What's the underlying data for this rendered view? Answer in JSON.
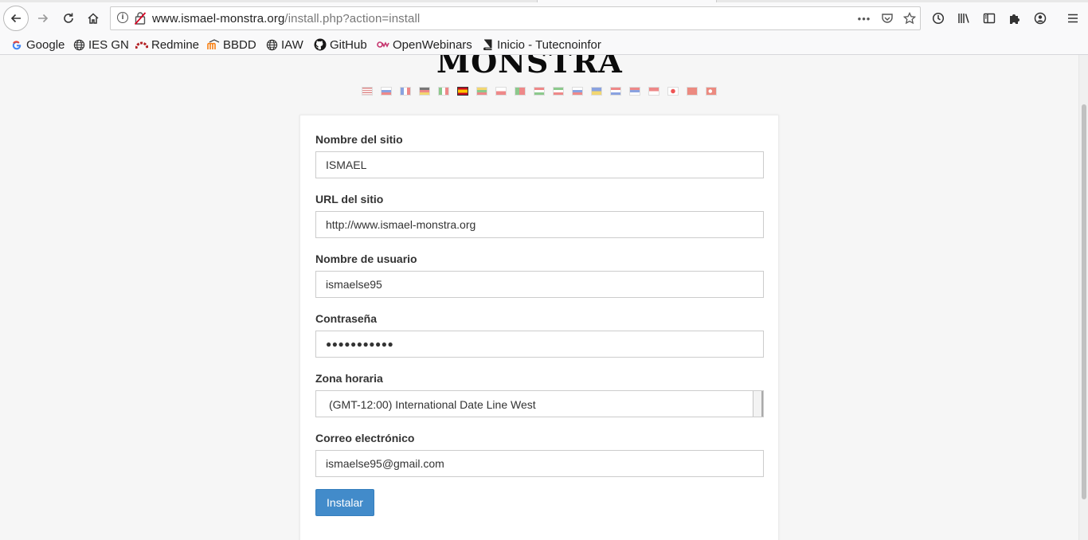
{
  "browser": {
    "url_host": "www.ismael-monstra.org",
    "url_path": "/install.php?action=install",
    "bookmarks": [
      {
        "label": "Google",
        "icon": "google-icon"
      },
      {
        "label": "IES GN",
        "icon": "globe-icon"
      },
      {
        "label": "Redmine",
        "icon": "redmine-icon"
      },
      {
        "label": "BBDD",
        "icon": "moodle-icon"
      },
      {
        "label": "IAW",
        "icon": "globe-icon"
      },
      {
        "label": "GitHub",
        "icon": "github-icon"
      },
      {
        "label": "OpenWebinars",
        "icon": "openwebinars-icon"
      },
      {
        "label": "Inicio - Tutecnoinfor",
        "icon": "book-icon"
      }
    ]
  },
  "page": {
    "logo": "MONSTRA",
    "languages": [
      "en",
      "ru",
      "fr",
      "de",
      "it",
      "es",
      "lt",
      "pl",
      "pt",
      "hu",
      "ir",
      "sk",
      "ua",
      "nl",
      "sr",
      "id",
      "ja",
      "zh",
      "tr"
    ],
    "form": {
      "site_name_label": "Nombre del sitio",
      "site_name_value": "ISMAEL",
      "site_url_label": "URL del sitio",
      "site_url_value": "http://www.ismael-monstra.org",
      "username_label": "Nombre de usuario",
      "username_value": "ismaelse95",
      "password_label": "Contraseña",
      "password_value": "●●●●●●●●●●●",
      "timezone_label": "Zona horaria",
      "timezone_value": "(GMT-12:00) International Date Line West",
      "email_label": "Correo electrónico",
      "email_value": "ismaelse95@gmail.com",
      "submit_label": "Instalar"
    }
  },
  "colors": {
    "button": "#428bca",
    "background": "#f6f6f6"
  }
}
